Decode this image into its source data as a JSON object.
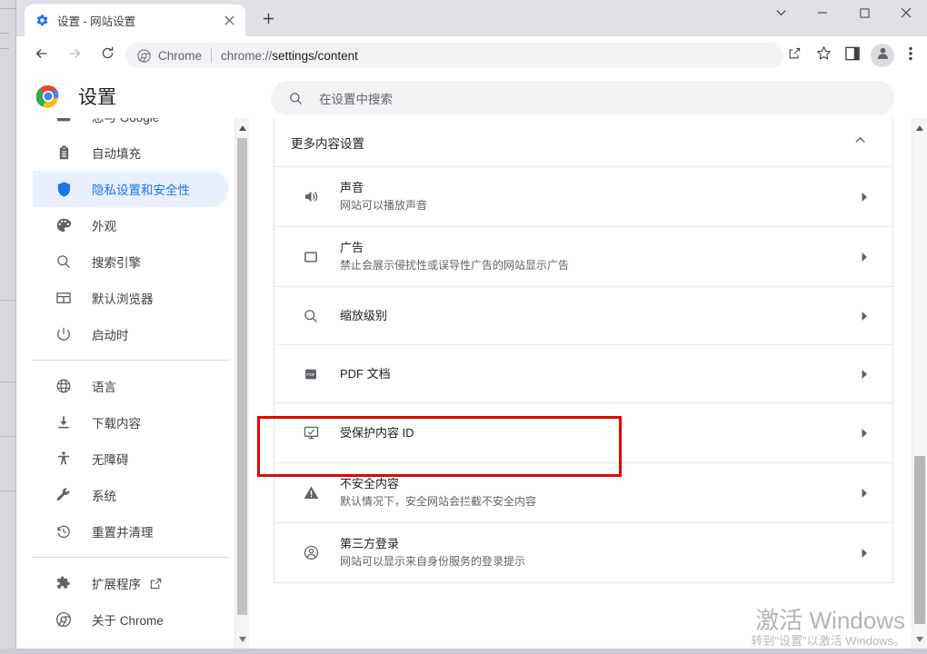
{
  "browser": {
    "tab": {
      "title": "设置 - 网站设置",
      "favicon_icon": "gear-icon",
      "close_icon": "close-icon"
    },
    "new_tab_icon": "plus-icon",
    "window_controls": {
      "chevron_icon": "chevron-down-icon",
      "minimize_icon": "minimize-icon",
      "maximize_icon": "maximize-icon",
      "close_icon": "close-icon"
    },
    "toolbar": {
      "back_icon": "arrow-left-icon",
      "forward_icon": "arrow-right-icon",
      "reload_icon": "reload-icon",
      "omnibox": {
        "site_icon": "chrome-icon",
        "site_label": "Chrome",
        "url_scheme": "chrome://",
        "url_path": "settings/content"
      },
      "share_icon": "share-icon",
      "bookmark_icon": "star-icon",
      "side_panel_icon": "side-panel-icon",
      "profile_icon": "avatar-icon",
      "menu_icon": "three-dot-menu-icon"
    }
  },
  "settings": {
    "logo_icon": "chrome-logo-icon",
    "title": "设置",
    "search": {
      "icon": "search-icon",
      "placeholder": "在设置中搜索",
      "value": ""
    },
    "sidebar": {
      "items": [
        {
          "label": "您与 Google",
          "icon": "person-card-icon",
          "selected": false,
          "cut_off": true
        },
        {
          "label": "自动填充",
          "icon": "clipboard-icon",
          "selected": false
        },
        {
          "label": "隐私设置和安全性",
          "icon": "shield-icon",
          "selected": true
        },
        {
          "label": "外观",
          "icon": "palette-icon",
          "selected": false
        },
        {
          "label": "搜索引擎",
          "icon": "search-icon",
          "selected": false
        },
        {
          "label": "默认浏览器",
          "icon": "browser-window-icon",
          "selected": false
        },
        {
          "label": "启动时",
          "icon": "power-icon",
          "selected": false
        }
      ],
      "items2": [
        {
          "label": "语言",
          "icon": "globe-icon"
        },
        {
          "label": "下载内容",
          "icon": "download-icon"
        },
        {
          "label": "无障碍",
          "icon": "accessibility-icon"
        },
        {
          "label": "系统",
          "icon": "wrench-icon"
        },
        {
          "label": "重置并清理",
          "icon": "history-restore-icon"
        }
      ],
      "items3": [
        {
          "label": "扩展程序",
          "icon": "puzzle-icon",
          "external_icon": "external-link-icon"
        },
        {
          "label": "关于 Chrome",
          "icon": "chrome-outline-icon"
        }
      ]
    },
    "content_section": {
      "title": "更多内容设置",
      "collapse_icon": "chevron-up-icon",
      "rows": [
        {
          "title": "声音",
          "subtitle": "网站可以播放声音",
          "icon": "volume-icon",
          "arrow_icon": "chevron-right-icon",
          "highlighted": false
        },
        {
          "title": "广告",
          "subtitle": "禁止会展示侵扰性或误导性广告的网站显示广告",
          "icon": "ads-icon",
          "arrow_icon": "chevron-right-icon",
          "highlighted": false
        },
        {
          "title": "缩放级别",
          "subtitle": "",
          "icon": "zoom-search-icon",
          "arrow_icon": "chevron-right-icon",
          "highlighted": false
        },
        {
          "title": "PDF 文档",
          "subtitle": "",
          "icon": "pdf-icon",
          "arrow_icon": "chevron-right-icon",
          "highlighted": false
        },
        {
          "title": "受保护内容 ID",
          "subtitle": "",
          "icon": "protected-content-icon",
          "arrow_icon": "chevron-right-icon",
          "highlighted": true
        },
        {
          "title": "不安全内容",
          "subtitle": "默认情况下，安全网站会拦截不安全内容",
          "icon": "warning-triangle-icon",
          "arrow_icon": "chevron-right-icon",
          "highlighted": false
        },
        {
          "title": "第三方登录",
          "subtitle": "网站可以显示来自身份服务的登录提示",
          "icon": "account-circle-icon",
          "arrow_icon": "chevron-right-icon",
          "highlighted": false
        }
      ]
    }
  },
  "annotation": {
    "color": "#e60000",
    "target": "受保护内容 ID"
  },
  "watermark": {
    "line1": "激活 Windows",
    "line2": "转到\"设置\"以激活 Windows。"
  },
  "colors": {
    "accent": "#1a73e8",
    "selected_bg": "#e8f0fe",
    "tabstrip": "#dee1e6",
    "omnibox_bg": "#f1f3f4",
    "annotation": "#e60000"
  }
}
